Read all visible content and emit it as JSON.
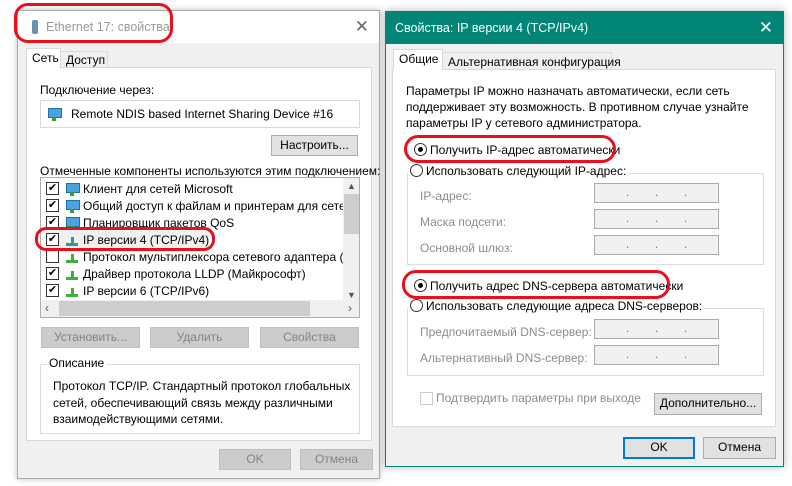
{
  "left": {
    "title": "Ethernet 17: свойства",
    "tabs": [
      "Сеть",
      "Доступ"
    ],
    "connect_via_label": "Подключение через:",
    "device": "Remote NDIS based Internet Sharing Device #16",
    "configure": "Настроить...",
    "components_label": "Отмеченные компоненты используются этим подключением:",
    "components": [
      {
        "label": "Клиент для сетей Microsoft",
        "checked": true,
        "icon": "pc"
      },
      {
        "label": "Общий доступ к файлам и принтерам для сетей Mi",
        "checked": true,
        "icon": "pc"
      },
      {
        "label": "Планировщик пакетов QoS",
        "checked": true,
        "icon": "pc"
      },
      {
        "label": "IP версии 4 (TCP/IPv4)",
        "checked": true,
        "icon": "proto"
      },
      {
        "label": "Протокол мультиплексора сетевого адаптера (Май",
        "checked": false,
        "icon": "proto"
      },
      {
        "label": "Драйвер протокола LLDP (Майкрософт)",
        "checked": true,
        "icon": "proto"
      },
      {
        "label": "IP версии 6 (TCP/IPv6)",
        "checked": true,
        "icon": "proto"
      }
    ],
    "install": "Установить...",
    "remove": "Удалить",
    "properties": "Свойства",
    "description_label": "Описание",
    "description": [
      "Протокол TCP/IP. Стандартный протокол глобальных",
      "сетей, обеспечивающий связь между различными",
      "взаимодействующими сетями."
    ],
    "ok": "OK",
    "cancel": "Отмена"
  },
  "right": {
    "title": "Свойства: IP версии 4 (TCP/IPv4)",
    "tabs": [
      "Общие",
      "Альтернативная конфигурация"
    ],
    "intro": [
      "Параметры IP можно назначать автоматически, если сеть",
      "поддерживает эту возможность. В противном случае узнайте",
      "параметры IP у сетевого администратора."
    ],
    "auto_ip": "Получить IP-адрес автоматически",
    "manual_ip": "Использовать следующий IP-адрес:",
    "ip_label": "IP-адрес:",
    "mask_label": "Маска подсети:",
    "gateway_label": "Основной шлюз:",
    "auto_dns": "Получить адрес DNS-сервера автоматически",
    "manual_dns": "Использовать следующие адреса DNS-серверов:",
    "pref_dns": "Предпочитаемый DNS-сервер:",
    "alt_dns": "Альтернативный DNS-сервер:",
    "validate": "Подтвердить параметры при выходе",
    "advanced": "Дополнительно...",
    "ok": "OK",
    "cancel": "Отмена"
  },
  "colors": {
    "accent": "#008577",
    "highlight": "#e8101a"
  }
}
